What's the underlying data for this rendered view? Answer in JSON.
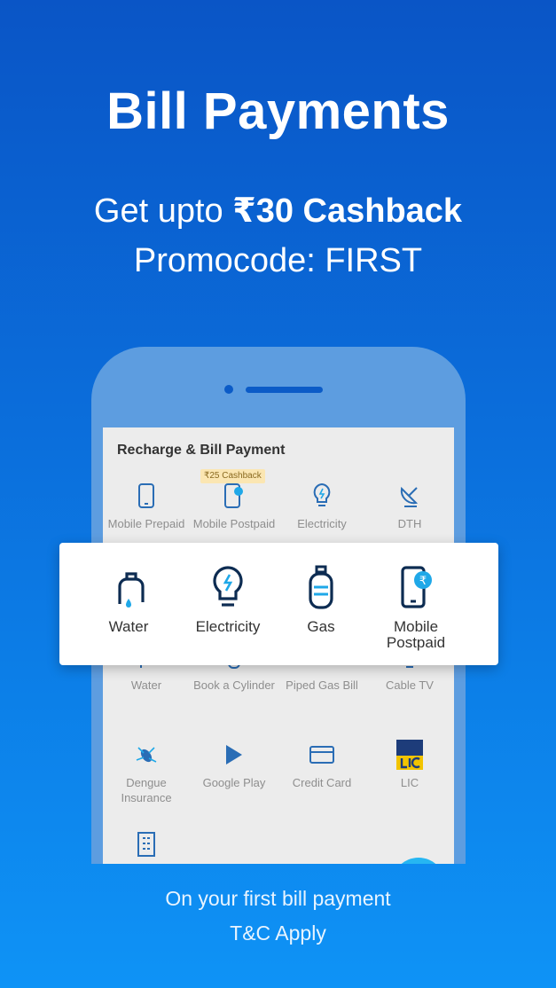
{
  "hero": {
    "title": "Bill Payments",
    "offer_prefix": "Get upto ",
    "offer_highlight": "₹30 Cashback",
    "promo_line": "Promocode:  FIRST"
  },
  "phone_screen": {
    "title": "Recharge & Bill Payment",
    "cashback_tag": "₹25 Cashback",
    "rows": [
      [
        {
          "label": "Mobile Prepaid",
          "icon": "mobile-icon"
        },
        {
          "label": "Mobile Postpaid",
          "icon": "mobile-rupee-icon"
        },
        {
          "label": "Electricity",
          "icon": "bulb-icon"
        },
        {
          "label": "DTH",
          "icon": "satellite-dish-icon"
        }
      ],
      [
        {
          "label": "Water",
          "icon": "tap-icon"
        },
        {
          "label": "Book a Cylinder",
          "icon": "cylinder-icon"
        },
        {
          "label": "Piped Gas Bill",
          "icon": "pipe-icon"
        },
        {
          "label": "Cable TV",
          "icon": "tv-icon"
        }
      ],
      [
        {
          "label": "Dengue Insurance",
          "icon": "mosquito-icon"
        },
        {
          "label": "Google Play",
          "icon": "google-play-icon"
        },
        {
          "label": "Credit Card",
          "icon": "credit-card-icon"
        },
        {
          "label": "LIC",
          "icon": "lic-logo-icon"
        }
      ]
    ]
  },
  "card": {
    "items": [
      {
        "label": "Water",
        "icon": "tap-icon"
      },
      {
        "label": "Electricity",
        "icon": "bulb-icon"
      },
      {
        "label": "Gas",
        "icon": "gas-cylinder-icon"
      },
      {
        "label": "Mobile Postpaid",
        "icon": "mobile-rupee-icon"
      }
    ]
  },
  "footer": {
    "line1": "On your first bill payment",
    "line2": "T&C Apply"
  },
  "colors": {
    "bg_top": "#0a55c6",
    "bg_bottom": "#0e93f6",
    "icon_dark": "#0d2c52",
    "icon_accent": "#1fa8e8"
  }
}
